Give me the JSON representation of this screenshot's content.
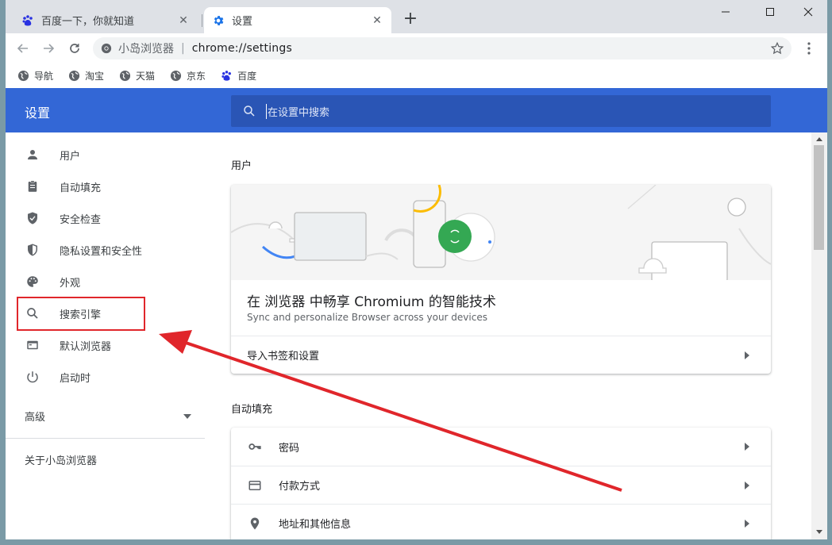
{
  "tabs": [
    {
      "title": "百度一下，你就知道",
      "favicon": "baidu-paw-icon",
      "active": false
    },
    {
      "title": "设置",
      "favicon": "gear-icon",
      "active": true
    }
  ],
  "toolbar": {
    "site_name": "小岛浏览器",
    "url": "chrome://settings"
  },
  "bookmarks": [
    {
      "label": "导航",
      "icon": "globe-icon"
    },
    {
      "label": "淘宝",
      "icon": "globe-icon"
    },
    {
      "label": "天猫",
      "icon": "globe-icon"
    },
    {
      "label": "京东",
      "icon": "globe-icon"
    },
    {
      "label": "百度",
      "icon": "baidu-paw-icon"
    }
  ],
  "header": {
    "title": "设置",
    "search_placeholder": "在设置中搜索"
  },
  "sidebar": {
    "items": [
      {
        "label": "用户",
        "icon": "person-icon"
      },
      {
        "label": "自动填充",
        "icon": "clipboard-icon"
      },
      {
        "label": "安全检查",
        "icon": "shield-check-icon"
      },
      {
        "label": "隐私设置和安全性",
        "icon": "shield-half-icon"
      },
      {
        "label": "外观",
        "icon": "palette-icon"
      },
      {
        "label": "搜索引擎",
        "icon": "search-icon"
      },
      {
        "label": "默认浏览器",
        "icon": "browser-window-icon"
      },
      {
        "label": "启动时",
        "icon": "power-icon"
      }
    ],
    "advanced_label": "高级",
    "about_label": "关于小岛浏览器"
  },
  "main": {
    "users_section_title": "用户",
    "promo_title": "在 浏览器 中畅享 Chromium 的智能技术",
    "promo_subtitle": "Sync and personalize Browser across your devices",
    "import_label": "导入书签和设置",
    "autofill_section_title": "自动填充",
    "autofill_rows": [
      {
        "label": "密码",
        "icon": "key-icon"
      },
      {
        "label": "付款方式",
        "icon": "credit-card-icon"
      },
      {
        "label": "地址和其他信息",
        "icon": "location-pin-icon"
      }
    ]
  },
  "colors": {
    "header_blue": "#3367d6",
    "search_blue": "#2a55b5",
    "annotation_red": "#e0262b"
  }
}
